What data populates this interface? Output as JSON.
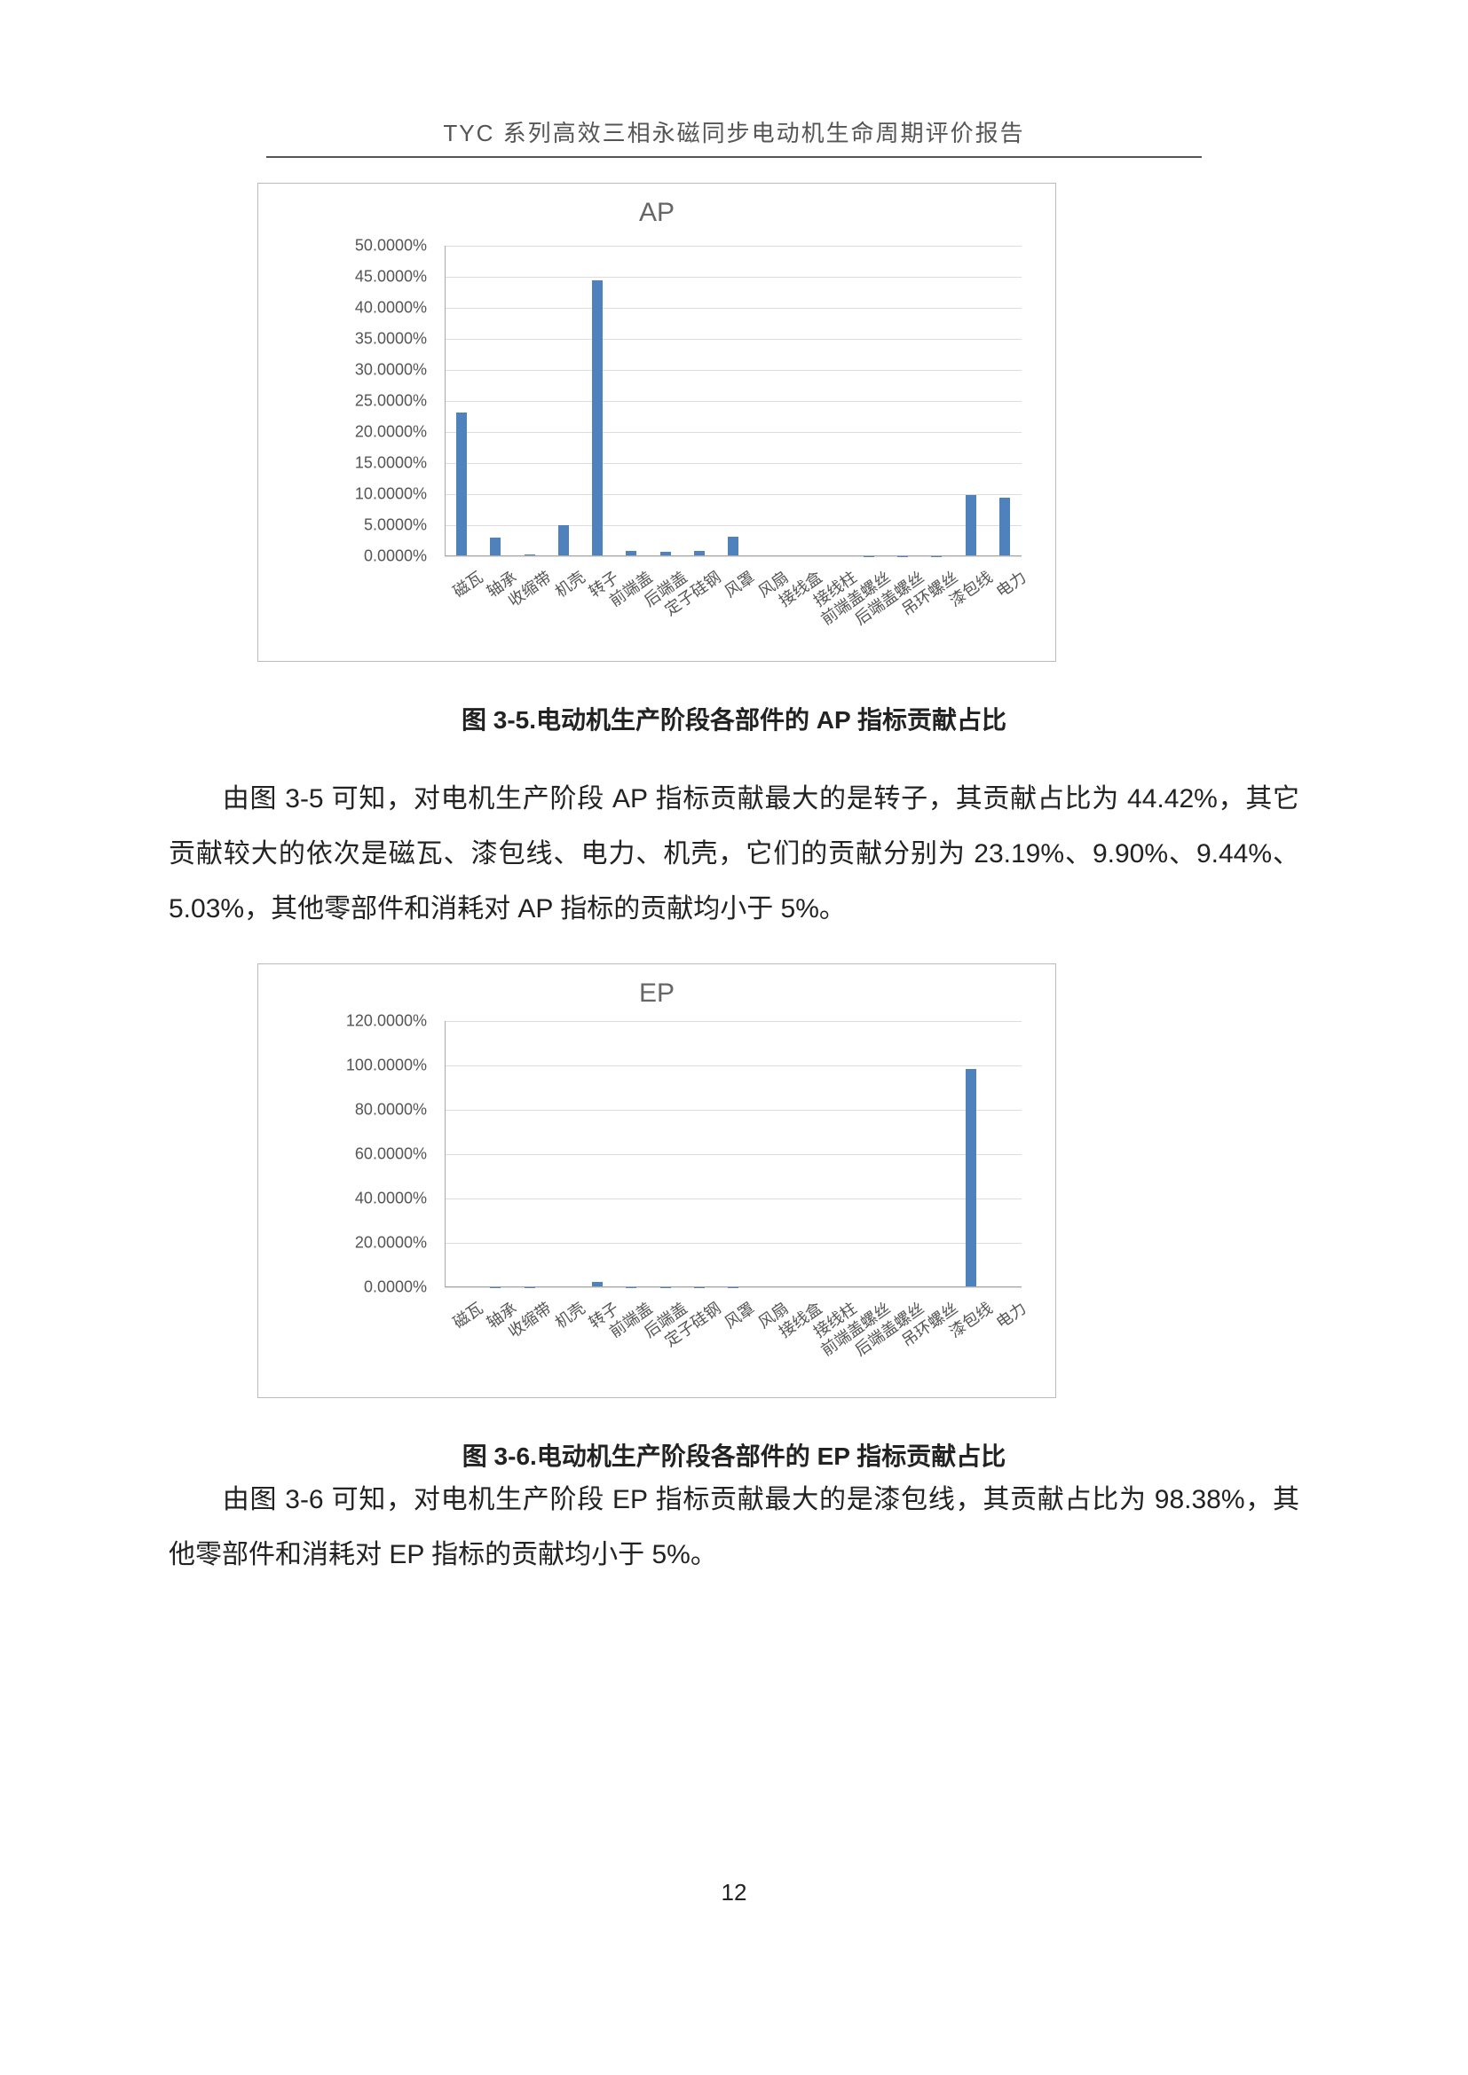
{
  "header": {
    "title": "TYC 系列高效三相永磁同步电动机生命周期评价报告"
  },
  "page_number": "12",
  "captions": {
    "fig35": "图 3-5.电动机生产阶段各部件的 AP 指标贡献占比",
    "fig36": "图 3-6.电动机生产阶段各部件的 EP 指标贡献占比"
  },
  "paragraphs": {
    "p1": "由图 3-5 可知，对电机生产阶段 AP 指标贡献最大的是转子，其贡献占比为 44.42%，其它贡献较大的依次是磁瓦、漆包线、电力、机壳，它们的贡献分别为 23.19%、9.90%、9.44%、5.03%，其他零部件和消耗对 AP 指标的贡献均小于 5%。",
    "p2": "由图 3-6 可知，对电机生产阶段 EP 指标贡献最大的是漆包线，其贡献占比为 98.38%，其他零部件和消耗对 EP 指标的贡献均小于 5%。"
  },
  "chart_data": [
    {
      "id": "ap",
      "type": "bar",
      "title": "AP",
      "xlabel": "",
      "ylabel": "",
      "ylim": [
        0,
        50
      ],
      "y_tick_step": 5,
      "y_tick_format": "0.0000%",
      "categories": [
        "磁瓦",
        "轴承",
        "收缩带",
        "机壳",
        "转子",
        "前端盖",
        "后端盖",
        "定子硅钢",
        "风罩",
        "风扇",
        "接线盒",
        "接线柱",
        "前端盖螺丝",
        "后端盖螺丝",
        "吊环螺丝",
        "漆包线",
        "电力"
      ],
      "values": [
        23.19,
        3.0,
        0.3,
        5.03,
        44.42,
        0.9,
        0.7,
        0.8,
        3.2,
        0.1,
        0.1,
        0.1,
        0.05,
        0.05,
        0.05,
        9.9,
        9.44
      ]
    },
    {
      "id": "ep",
      "type": "bar",
      "title": "EP",
      "xlabel": "",
      "ylabel": "",
      "ylim": [
        0,
        120
      ],
      "y_tick_step": 20,
      "y_tick_format": "0.0000%",
      "categories": [
        "磁瓦",
        "轴承",
        "收缩带",
        "机壳",
        "转子",
        "前端盖",
        "后端盖",
        "定子硅钢",
        "风罩",
        "风扇",
        "接线盒",
        "接线柱",
        "前端盖螺丝",
        "后端盖螺丝",
        "吊环螺丝",
        "漆包线",
        "电力"
      ],
      "values": [
        0.5,
        0.1,
        0.05,
        0.3,
        2.5,
        0.1,
        0.05,
        0.1,
        0.1,
        0.02,
        0.02,
        0.02,
        0.01,
        0.01,
        0.01,
        98.38,
        0.3
      ]
    }
  ]
}
